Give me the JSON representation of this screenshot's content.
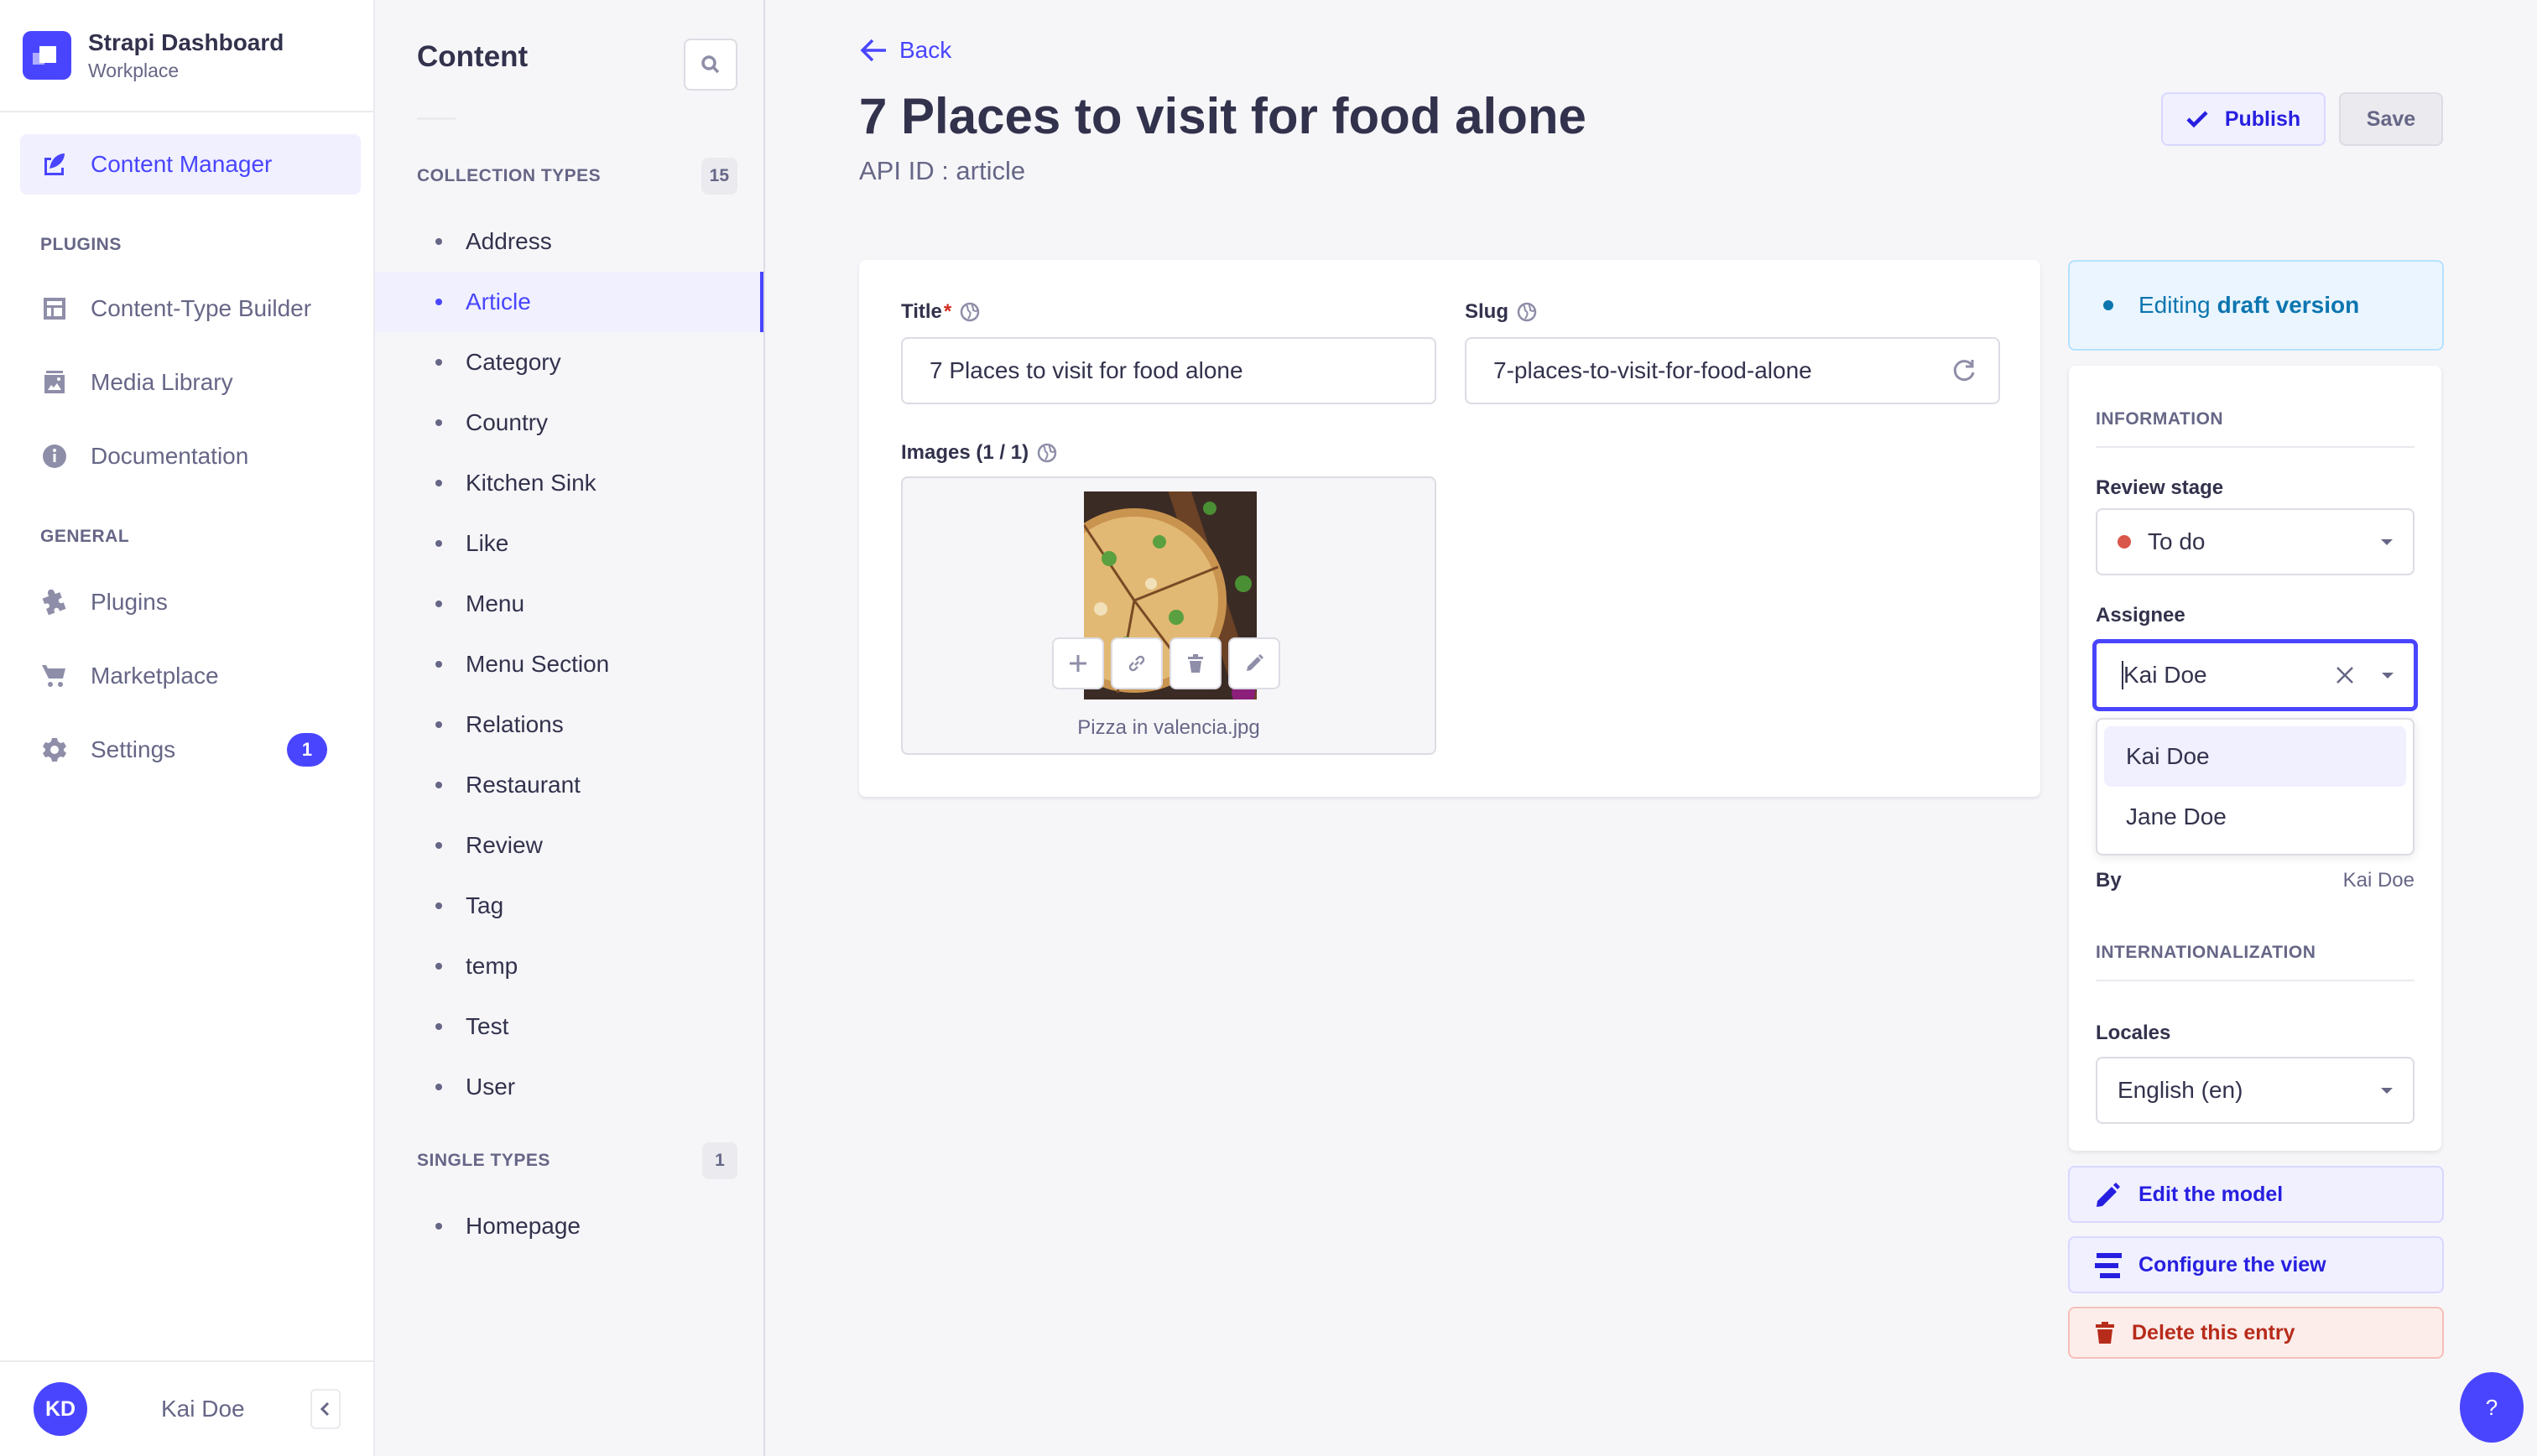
{
  "brand": {
    "title": "Strapi Dashboard",
    "subtitle": "Workplace"
  },
  "nav": {
    "content_manager": "Content Manager",
    "plugins_section": "PLUGINS",
    "plugins_items": [
      "Content-Type Builder",
      "Media Library",
      "Documentation"
    ],
    "general_section": "GENERAL",
    "general_items": [
      "Plugins",
      "Marketplace",
      "Settings"
    ],
    "settings_badge": "1",
    "user_initials": "KD",
    "user_name": "Kai Doe"
  },
  "subnav": {
    "title": "Content",
    "collection_label": "COLLECTION TYPES",
    "collection_count": "15",
    "collection_items": [
      "Address",
      "Article",
      "Category",
      "Country",
      "Kitchen Sink",
      "Like",
      "Menu",
      "Menu Section",
      "Relations",
      "Restaurant",
      "Review",
      "Tag",
      "temp",
      "Test",
      "User"
    ],
    "active_item": "Article",
    "single_label": "SINGLE TYPES",
    "single_count": "1",
    "single_items": [
      "Homepage"
    ]
  },
  "header": {
    "back": "Back",
    "title": "7 Places to visit for food alone",
    "api_id": "API ID : article",
    "publish": "Publish",
    "save": "Save"
  },
  "form": {
    "title_label": "Title",
    "title_required": "*",
    "title_value": "7 Places to visit for food alone",
    "slug_label": "Slug",
    "slug_value": "7-places-to-visit-for-food-alone",
    "images_label": "Images (1 / 1)",
    "image_name": "Pizza in valencia.jpg"
  },
  "panel": {
    "draft_prefix": "Editing",
    "draft_strong": "draft version",
    "info_heading": "INFORMATION",
    "review_stage_label": "Review stage",
    "review_stage_value": "To do",
    "review_stage_color": "#d9574a",
    "assignee_label": "Assignee",
    "assignee_value": "Kai Doe",
    "assignee_options": [
      "Kai Doe",
      "Jane Doe"
    ],
    "by_label": "By",
    "by_value": "Kai Doe",
    "i18n_heading": "INTERNATIONALIZATION",
    "locales_label": "Locales",
    "locales_value": "English (en)",
    "edit_model": "Edit the model",
    "configure_view": "Configure the view",
    "delete_entry": "Delete this entry"
  },
  "help": "?"
}
